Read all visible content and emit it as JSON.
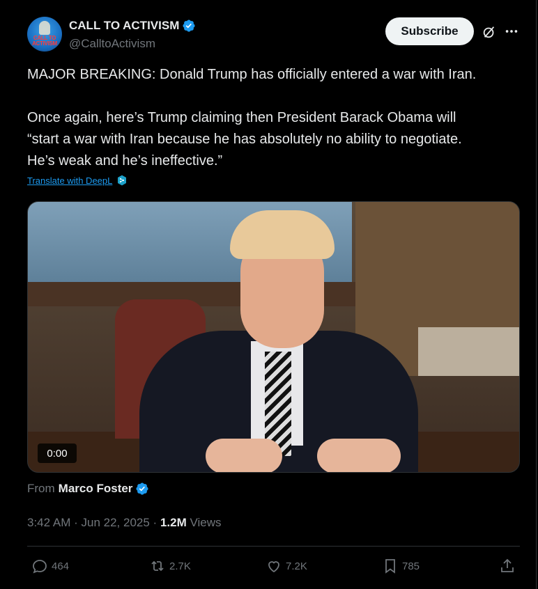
{
  "account": {
    "display_name": "CALL TO ACTIVISM",
    "handle": "@CalltoActivism",
    "avatar_text": "CALL TO ACTIVISM",
    "verified_icon": "verified-badge-icon"
  },
  "header_actions": {
    "subscribe_label": "Subscribe",
    "grok_icon": "grok-icon",
    "more_icon": "more-icon"
  },
  "tweet": {
    "line1": "MAJOR BREAKING: Donald Trump has officially entered a war with Iran.",
    "line2": "Once again, here’s Trump claiming then President Barack Obama will",
    "line3": "“start a war with Iran because he has absolutely no ability to negotiate.",
    "line4": "He’s weak and he’s ineffective.”",
    "translate_label": "Translate with DeepL"
  },
  "media": {
    "duration": "0:00"
  },
  "attribution": {
    "prefix": "From",
    "name": "Marco Foster"
  },
  "meta": {
    "time": "3:42 AM",
    "separator": "·",
    "date": "Jun 22, 2025",
    "views_count": "1.2M",
    "views_label": "Views"
  },
  "actions": {
    "replies": "464",
    "reposts": "2.7K",
    "likes": "7.2K",
    "bookmarks": "785"
  },
  "colors": {
    "background": "#000000",
    "text": "#e7e9ea",
    "muted": "#71767b",
    "accent": "#1d9bf0",
    "divider": "#2f3336"
  }
}
